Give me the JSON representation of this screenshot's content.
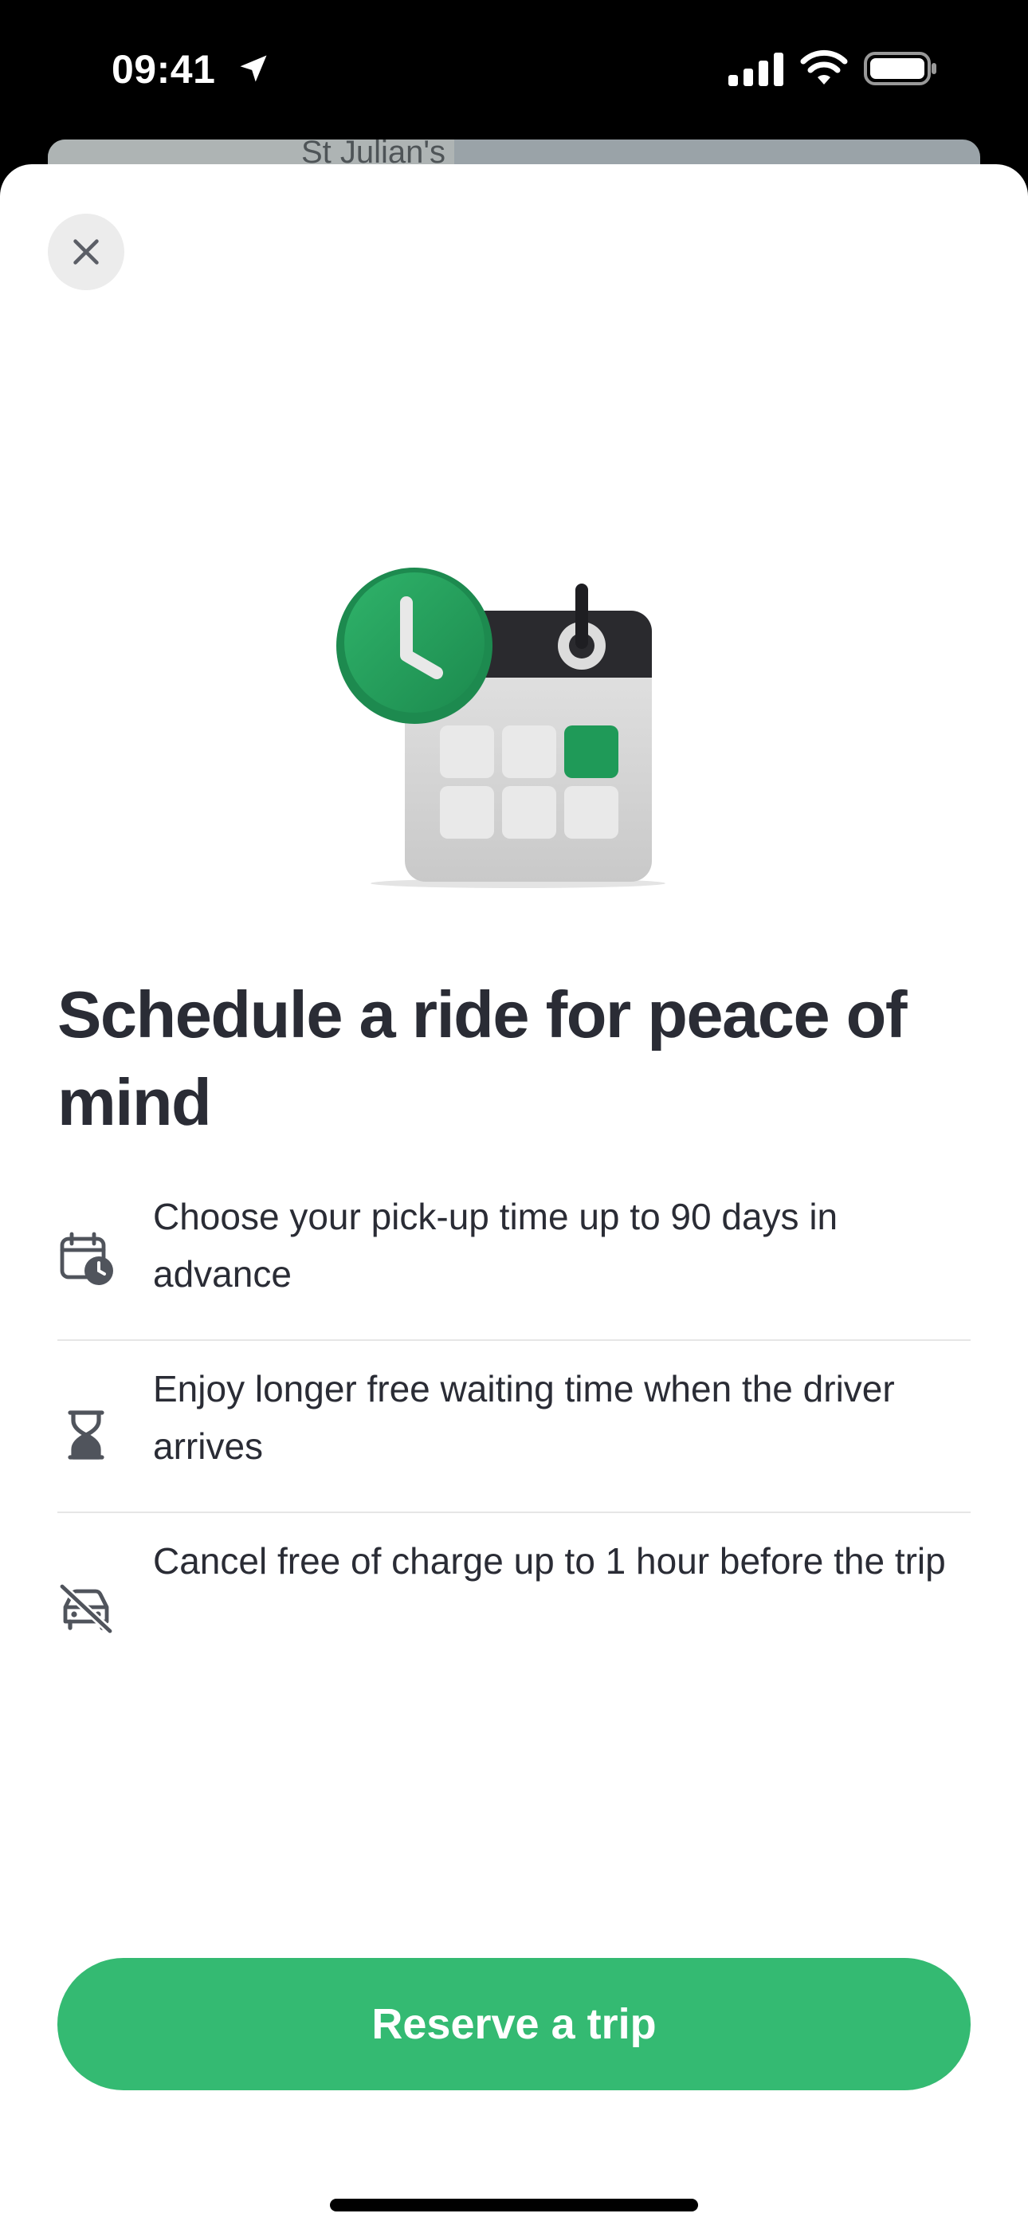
{
  "status_bar": {
    "time": "09:41"
  },
  "map": {
    "label": "St Julian's"
  },
  "sheet": {
    "close_icon": "close-icon",
    "hero_icon": "calendar-clock-illustration",
    "title": "Schedule a ride for peace of mind",
    "features": [
      {
        "icon": "calendar-clock-icon",
        "text": "Choose your pick-up time up to 90 days in advance"
      },
      {
        "icon": "hourglass-icon",
        "text": "Enjoy longer free waiting time when the driver arrives"
      },
      {
        "icon": "car-off-icon",
        "text": "Cancel free of charge up to 1 hour before the trip"
      }
    ],
    "primary_button": "Reserve a trip"
  },
  "colors": {
    "accent": "#34ba72",
    "text": "#2a2c35",
    "close_bg": "#ececec"
  }
}
